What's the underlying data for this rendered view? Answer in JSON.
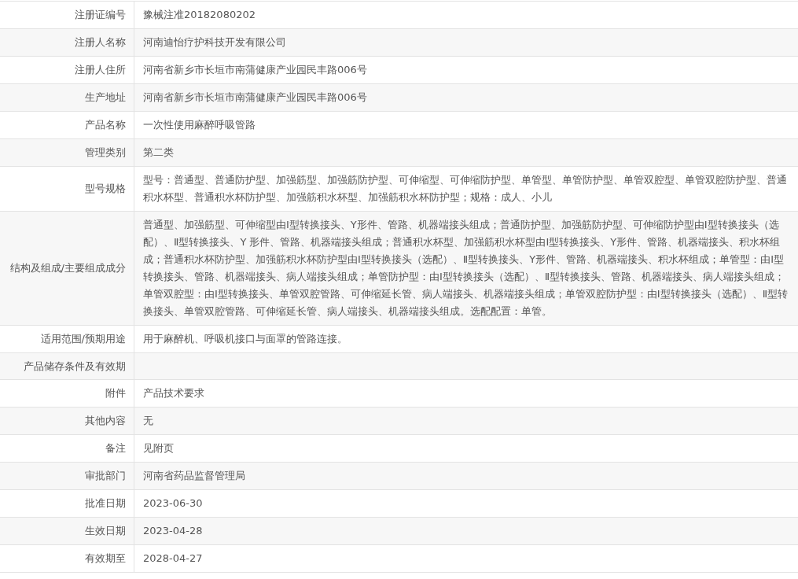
{
  "rows": [
    {
      "label": "注册证编号",
      "value": "豫械注准20182080202"
    },
    {
      "label": "注册人名称",
      "value": "河南迪怡疗护科技开发有限公司"
    },
    {
      "label": "注册人住所",
      "value": "河南省新乡市长垣市南蒲健康产业园民丰路006号"
    },
    {
      "label": "生产地址",
      "value": "河南省新乡市长垣市南蒲健康产业园民丰路006号"
    },
    {
      "label": "产品名称",
      "value": "一次性使用麻醉呼吸管路"
    },
    {
      "label": "管理类别",
      "value": "第二类"
    },
    {
      "label": "型号规格",
      "value": "型号：普通型、普通防护型、加强筋型、加强筋防护型、可伸缩型、可伸缩防护型、单管型、单管防护型、单管双腔型、单管双腔防护型、普通积水杯型、普通积水杯防护型、加强筋积水杯型、加强筋积水杯防护型；规格：成人、小儿"
    },
    {
      "label": "结构及组成/主要组成成分",
      "value": "普通型、加强筋型、可伸缩型由Ⅰ型转换接头、Y形件、管路、机器端接头组成；普通防护型、加强筋防护型、可伸缩防护型由Ⅰ型转换接头（选配）、Ⅱ型转换接头、Y 形件、管路、机器端接头组成；普通积水杯型、加强筋积水杯型由Ⅰ型转换接头、Y形件、管路、机器端接头、积水杯组成；普通积水杯防护型、加强筋积水杯防护型由Ⅰ型转换接头（选配）、Ⅱ型转换接头、Y形件、管路、机器端接头、积水杯组成；单管型：由Ⅰ型转换接头、管路、机器端接头、病人端接头组成；单管防护型：由Ⅰ型转换接头（选配）、Ⅱ型转换接头、管路、机器端接头、病人端接头组成；单管双腔型：由Ⅰ型转换接头、单管双腔管路、可伸缩延长管、病人端接头、机器端接头组成；单管双腔防护型：由Ⅰ型转换接头（选配）、Ⅱ型转换接头、单管双腔管路、可伸缩延长管、病人端接头、机器端接头组成。选配配置：单管。"
    },
    {
      "label": "适用范围/预期用途",
      "value": "用于麻醉机、呼吸机接口与面罩的管路连接。"
    },
    {
      "label": "产品储存条件及有效期"
    },
    {
      "label": "附件",
      "value": "产品技术要求"
    },
    {
      "label": "其他内容",
      "value": "无"
    },
    {
      "label": "备注",
      "value": "见附页"
    },
    {
      "label": "审批部门",
      "value": "河南省药品监督管理局"
    },
    {
      "label": "批准日期",
      "value": "2023-06-30"
    },
    {
      "label": "生效日期",
      "value": "2023-04-28"
    },
    {
      "label": "有效期至",
      "value": "2028-04-27"
    }
  ]
}
